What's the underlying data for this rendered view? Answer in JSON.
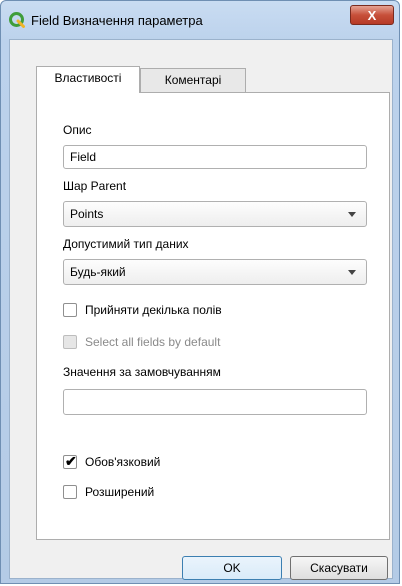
{
  "window": {
    "title": "Field Визначення параметра",
    "close_glyph": "X",
    "icon": "qgis-icon"
  },
  "tabs": [
    {
      "label": "Властивості",
      "active": true
    },
    {
      "label": "Коментарі",
      "active": false
    }
  ],
  "form": {
    "description": {
      "label": "Опис",
      "value": "Field"
    },
    "parent_layer": {
      "label": "Шар Parent",
      "selected": "Points"
    },
    "data_type": {
      "label": "Допустимий тип даних",
      "selected": "Будь-який"
    },
    "multiple_fields": {
      "label": "Прийняти декілька полів",
      "checked": false,
      "enabled": true
    },
    "select_all": {
      "label": "Select all fields by default",
      "checked": false,
      "enabled": false
    },
    "default_value": {
      "label": "Значення за замовчуванням",
      "value": ""
    },
    "mandatory": {
      "label": "Обов'язковий",
      "checked": true,
      "check_glyph": "✔"
    },
    "advanced": {
      "label": "Розширений",
      "checked": false
    }
  },
  "buttons": {
    "ok": "OK",
    "cancel": "Скасувати"
  }
}
